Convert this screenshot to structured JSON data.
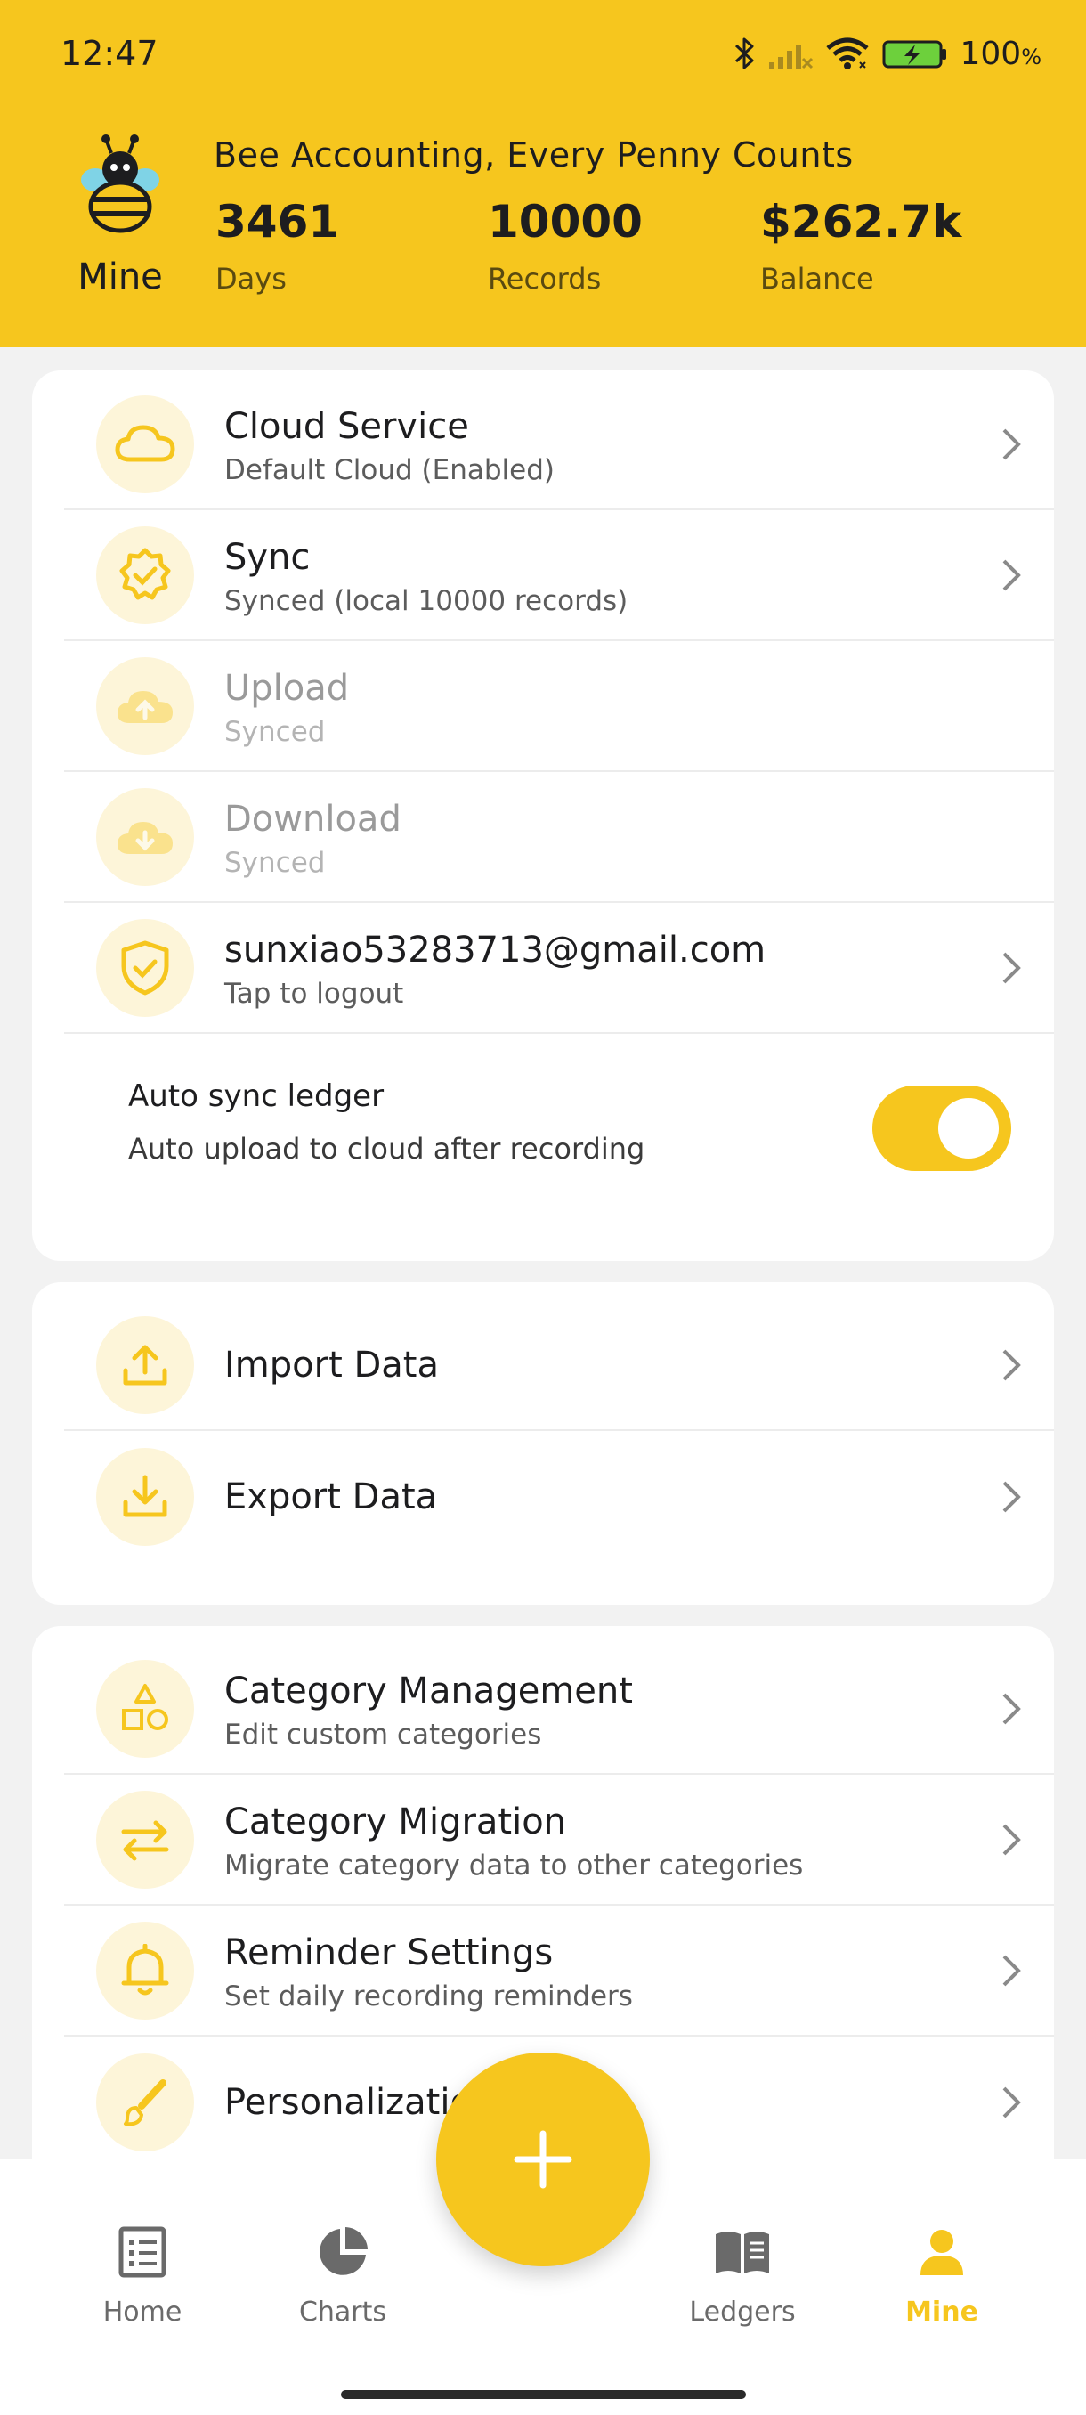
{
  "status_bar": {
    "time": "12:47",
    "battery": "100",
    "battery_unit": "%"
  },
  "profile": {
    "label": "Mine",
    "slogan": "Bee Accounting, Every Penny Counts"
  },
  "stats": [
    {
      "value": "3461",
      "label": "Days"
    },
    {
      "value": "10000",
      "label": "Records"
    },
    {
      "value": "$262.7k",
      "label": "Balance"
    }
  ],
  "cloud_card": {
    "rows": [
      {
        "title": "Cloud Service",
        "subtitle": "Default Cloud (Enabled)",
        "icon": "cloud-icon",
        "enabled": true
      },
      {
        "title": "Sync",
        "subtitle": "Synced (local 10000 records)",
        "icon": "sync-badge-icon",
        "enabled": true
      },
      {
        "title": "Upload",
        "subtitle": "Synced",
        "icon": "cloud-upload-icon",
        "enabled": false
      },
      {
        "title": "Download",
        "subtitle": "Synced",
        "icon": "cloud-download-icon",
        "enabled": false
      },
      {
        "title": "sunxiao53283713@gmail.com",
        "subtitle": "Tap to logout",
        "icon": "shield-check-icon",
        "enabled": true
      }
    ],
    "auto_sync": {
      "title": "Auto sync ledger",
      "subtitle": "Auto upload to cloud after recording",
      "on": true
    }
  },
  "data_card": {
    "rows": [
      {
        "title": "Import Data",
        "icon": "import-icon"
      },
      {
        "title": "Export Data",
        "icon": "export-icon"
      }
    ]
  },
  "settings_card": {
    "rows": [
      {
        "title": "Category Management",
        "subtitle": "Edit custom categories",
        "icon": "shapes-icon"
      },
      {
        "title": "Category Migration",
        "subtitle": "Migrate category data to other categories",
        "icon": "swap-arrows-icon"
      },
      {
        "title": "Reminder Settings",
        "subtitle": "Set daily recording reminders",
        "icon": "bell-icon"
      },
      {
        "title": "Personalization",
        "icon": "brush-icon"
      }
    ]
  },
  "bottom_nav": {
    "items": [
      {
        "label": "Home",
        "icon": "list-icon",
        "active": false
      },
      {
        "label": "Charts",
        "icon": "pie-chart-icon",
        "active": false
      },
      {
        "label": "Ledgers",
        "icon": "book-icon",
        "active": false
      },
      {
        "label": "Mine",
        "icon": "person-icon",
        "active": true
      }
    ]
  },
  "colors": {
    "accent": "#f6c61e",
    "icon_bg": "#fdf5d9",
    "page_bg": "#f2f2f2"
  }
}
